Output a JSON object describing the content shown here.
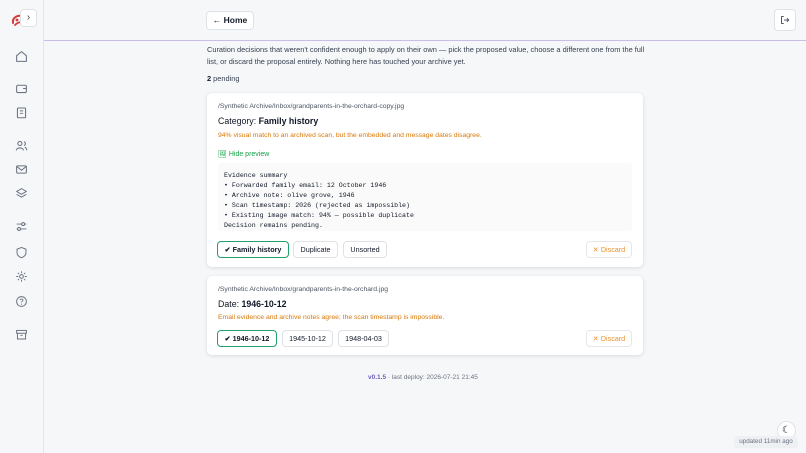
{
  "sidebar": {
    "collapse_label": "›",
    "icons": [
      "home-icon",
      "wallet-icon",
      "clipboard-icon",
      "users-icon",
      "mail-icon",
      "layers-icon",
      "sliders-icon",
      "shield-icon",
      "sparkle-icon",
      "help-icon",
      "archive-icon"
    ]
  },
  "header": {
    "home_label": "← Home"
  },
  "intro": "Curation decisions that weren't confident enough to apply on their own — pick the proposed value, choose a different one from the full list, or discard the proposal entirely. Nothing here has touched your archive yet.",
  "pending": {
    "count": "2",
    "label": " pending"
  },
  "cards": [
    {
      "path": "/Synthetic Archive/Inbox/grandparents-in-the-orchard-copy.jpg",
      "field": "Category:",
      "value": "Family history",
      "note": "94% visual match to an archived scan, but the embedded and message dates disagree.",
      "preview_label": "Hide preview",
      "preview_text": "Evidence summary\n• Forwarded family email: 12 October 1946\n• Archive note: olive grove, 1946\n• Scan timestamp: 2026 (rejected as impossible)\n• Existing image match: 94% — possible duplicate\nDecision remains pending.",
      "options": [
        "✔ Family history",
        "Duplicate",
        "Unsorted"
      ],
      "discard": "✕ Discard"
    },
    {
      "path": "/Synthetic Archive/Inbox/grandparents-in-the-orchard.jpg",
      "field": "Date:",
      "value": "1946-10-12",
      "note": "Email evidence and archive notes agree; the scan timestamp is impossible.",
      "options": [
        "✔ 1946-10-12",
        "1945-10-12",
        "1948-04-03"
      ],
      "discard": "✕ Discard"
    }
  ],
  "footer": {
    "version": "v0.1.5",
    "deploy": " · last deploy: 2026-07-21 21:45"
  },
  "updated": "updated 11min ago",
  "colors": {
    "accent": "#6d5fc2",
    "selected_border": "#22a06b",
    "warning_text": "#d97706",
    "discard": "#e8912b",
    "link_green": "#16a34a"
  }
}
